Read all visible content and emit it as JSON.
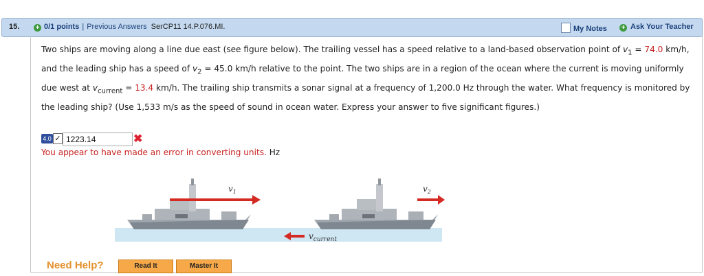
{
  "header": {
    "question_number": "15.",
    "points": "0/1 points",
    "separator": "|",
    "previous_answers": "Previous Answers",
    "problem_code": "SerCP11 14.P.076.MI.",
    "my_notes": "My Notes",
    "ask_teacher": "Ask Your Teacher"
  },
  "question": {
    "t1": "Two ships are moving along a line due east (see figure below). The trailing vessel has a speed relative to a land-based observation point of ",
    "v1_sym": "v",
    "v1_sub": "1",
    "eq1": " = ",
    "v1_val": "74.0",
    "t2": " km/h, and the leading ship has a speed of ",
    "v2_sym": "v",
    "v2_sub": "2",
    "t3": " = 45.0 km/h relative to the point. The two ships are in a region of the ocean where the current is moving uniformly due west at ",
    "vc_sym": "v",
    "vc_sub": "current",
    "eq2": " = ",
    "vc_val": "13.4",
    "t4": " km/h. The trailing ship transmits a sonar signal at a frequency of 1,200.0 Hz through the water. What frequency is monitored by the leading ship? (Use 1,533 m/s as the speed of sound in ocean water. Express your answer to five significant figures.)"
  },
  "answer": {
    "badge": "4.0",
    "check": "✓",
    "value": "1223.14",
    "incorrect_icon": "✖",
    "feedback": "You appear to have made an error in converting units.",
    "unit": "Hz"
  },
  "figure": {
    "v1_label": "v",
    "v1_sub": "1",
    "v2_label": "v",
    "v2_sub": "2",
    "vcurrent_label": "v",
    "vcurrent_sub": "current",
    "arrow_color": "#d42a22",
    "water_color": "#cfe6f3"
  },
  "help": {
    "label": "Need Help?",
    "read_it": "Read It",
    "master_it": "Master It"
  },
  "colors": {
    "header_bg": "#c4d9ef",
    "link": "#1a3f7a",
    "error_red": "#c81e1e",
    "help_orange": "#e5912e",
    "button_bg": "#f7a848"
  }
}
